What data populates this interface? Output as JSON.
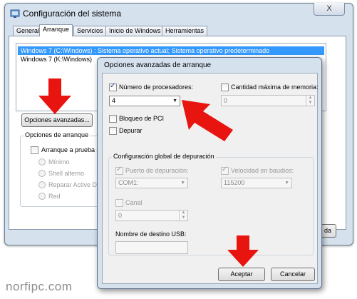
{
  "back_window": {
    "title": "Configuración del sistema",
    "close_label": "X",
    "tabs": [
      {
        "label": "General"
      },
      {
        "label": "Arranque"
      },
      {
        "label": "Servicios"
      },
      {
        "label": "Inicio de Windows"
      },
      {
        "label": "Herramientas"
      }
    ],
    "active_tab": "Arranque",
    "os_list": [
      "Windows 7 (C:\\Windows) : Sistema operativo actual; Sistema operativo predeterminado",
      "Windows 7 (K:\\Windows)"
    ],
    "advanced_button": "Opciones avanzadas...",
    "boot_options": {
      "legend": "Opciones de arranque",
      "safe_boot_label": "Arranque a prueba d",
      "radios": [
        "Mínimo",
        "Shell alterno",
        "Reparar Active Dir",
        "Red"
      ]
    },
    "partial_button": "da"
  },
  "dialog": {
    "title": "Opciones avanzadas de arranque",
    "num_processors": {
      "label": "Número de procesadores:",
      "checked": true,
      "value": "4"
    },
    "max_memory": {
      "label": "Cantidad máxima de memoria:",
      "checked": false,
      "value": "0"
    },
    "pci_lock": {
      "label": "Bloqueo de PCI",
      "checked": false
    },
    "debug": {
      "label": "Depurar",
      "checked": false
    },
    "debug_settings": {
      "legend": "Configuración global de depuración",
      "debug_port": {
        "label": "Puerto de depuración:",
        "checked": true,
        "value": "COM1:"
      },
      "baud_rate": {
        "label": "Velocidad en baudios:",
        "checked": true,
        "value": "115200"
      },
      "channel": {
        "label": "Canal",
        "checked": false,
        "value": "0"
      },
      "usb_target_label": "Nombre de destino USB:",
      "usb_target_value": ""
    },
    "accept_button": "Aceptar",
    "cancel_button": "Cancelar"
  },
  "watermark": "norfipc.com",
  "colors": {
    "window_frame": "#d6e1ee",
    "selection": "#3399ff",
    "arrow": "#e8140f"
  }
}
